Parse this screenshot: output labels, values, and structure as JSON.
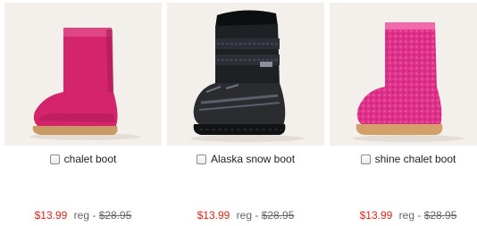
{
  "products": [
    {
      "name": "chalet boot",
      "sale_price": "$13.99",
      "reg_label": "reg -",
      "reg_price": "$28.95",
      "image_icon": "pink-suede-boot",
      "colors": {
        "main": "#d4246b",
        "dark": "#a81a52",
        "trim": "#e04584",
        "sole": "#c99a66"
      }
    },
    {
      "name": "Alaska snow boot",
      "sale_price": "$13.99",
      "reg_label": "reg -",
      "reg_price": "$28.95",
      "image_icon": "black-snow-boot",
      "colors": {
        "main": "#1e2024",
        "dark": "#0d0e10",
        "trim": "#5a606b",
        "sole": "#2a2c30"
      }
    },
    {
      "name": "shine chalet boot",
      "sale_price": "$13.99",
      "reg_label": "reg -",
      "reg_price": "$28.95",
      "image_icon": "pink-sparkle-boot",
      "colors": {
        "main": "#e0318a",
        "dark": "#b51e6c",
        "trim": "#f06aab",
        "sole": "#d3a06a"
      }
    }
  ],
  "accent": {
    "sale": "#e2231a",
    "regular": "#666666"
  }
}
